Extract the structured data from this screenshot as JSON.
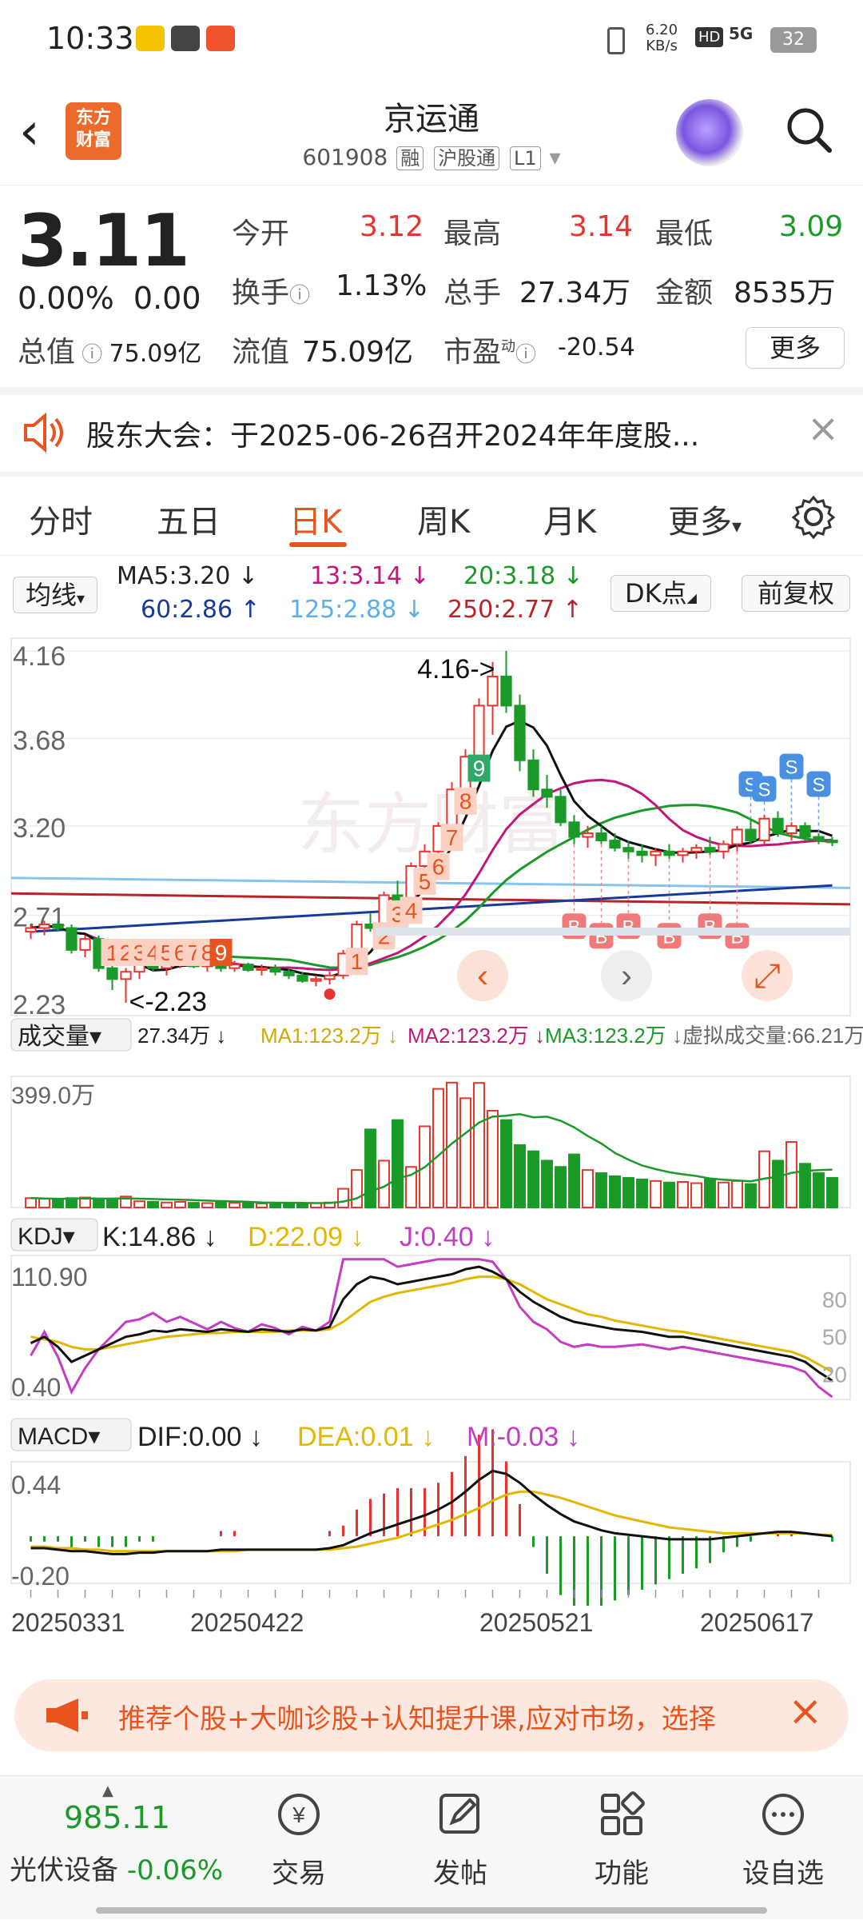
{
  "status": {
    "time": "10:33",
    "net_speed_value": "6.20",
    "net_speed_unit": "KB/s",
    "hd": "HD",
    "signal": "5G",
    "battery": "32"
  },
  "header": {
    "logo_line1": "东方",
    "logo_line2": "财富",
    "title": "京运通",
    "code": "601908",
    "tag1": "融",
    "tag2": "沪股通",
    "tag3": "L1"
  },
  "quote": {
    "price": "3.11",
    "change_pct": "0.00%",
    "change": "0.00",
    "open_label": "今开",
    "open": "3.12",
    "high_label": "最高",
    "high": "3.14",
    "low_label": "最低",
    "low": "3.09",
    "turnover_label": "换手",
    "turnover": "1.13%",
    "volume_label": "总手",
    "volume": "27.34万",
    "amount_label": "金额",
    "amount": "8535万",
    "mktcap_label": "总值",
    "mktcap": "75.09亿",
    "float_label": "流值",
    "float": "75.09亿",
    "pe_label": "市盈",
    "pe_sup": "动",
    "pe": "-20.54",
    "more": "更多"
  },
  "notice": {
    "text": "股东大会：于2025-06-26召开2024年年度股..."
  },
  "tabs": [
    {
      "label": "分时"
    },
    {
      "label": "五日"
    },
    {
      "label": "日K"
    },
    {
      "label": "周K"
    },
    {
      "label": "月K"
    },
    {
      "label": "更多"
    }
  ],
  "ma": {
    "selector": "均线",
    "ma5": "MA5:3.20 ↓",
    "ma13": "13:3.14 ↓",
    "ma20": "20:3.18 ↓",
    "ma60": "60:2.86 ↑",
    "ma125": "125:2.88 ↓",
    "ma250": "250:2.77 ↑",
    "dk": "DK点",
    "fq": "前复权"
  },
  "kline": {
    "y_labels": [
      "4.16",
      "3.68",
      "3.20",
      "2.71",
      "2.23"
    ],
    "max_annot": "4.16->",
    "min_annot": "<-2.23",
    "buy_mark": "B",
    "sell_mark": "S",
    "seq_buy": [
      "1",
      "2",
      "3",
      "4",
      "5",
      "6",
      "7",
      "8",
      "9"
    ],
    "seq_sell": [
      "1",
      "2",
      "3",
      "4",
      "5",
      "6",
      "7",
      "8",
      "9"
    ]
  },
  "volume": {
    "selector": "成交量",
    "vol": "27.34万 ↓",
    "ma1": "MA1:123.2万 ↓",
    "ma2": "MA2:123.2万 ↓",
    "ma3": "MA3:123.2万 ↓",
    "virtual": "虚拟成交量:66.21万",
    "ymax": "399.0万"
  },
  "kdj": {
    "selector": "KDJ",
    "k": "K:14.86 ↓",
    "d": "D:22.09 ↓",
    "j": "J:0.40 ↓",
    "ymax": "110.90",
    "ymin": "0.40",
    "levels": [
      "80",
      "50",
      "20"
    ]
  },
  "macd": {
    "selector": "MACD",
    "dif": "DIF:0.00 ↓",
    "dea": "DEA:0.01 ↓",
    "m": "M:-0.03 ↓",
    "ymax": "0.44",
    "ymin": "-0.20"
  },
  "dates": [
    "20250331",
    "20250422",
    "20250521",
    "20250617"
  ],
  "chart_data": {
    "type": "candlestick",
    "title": "京运通 601908 日K",
    "ylim": [
      2.23,
      4.16
    ],
    "ohlc": [
      [
        2.62,
        2.66,
        2.58,
        2.64
      ],
      [
        2.64,
        2.68,
        2.6,
        2.66
      ],
      [
        2.66,
        2.68,
        2.62,
        2.64
      ],
      [
        2.64,
        2.66,
        2.5,
        2.52
      ],
      [
        2.52,
        2.6,
        2.48,
        2.58
      ],
      [
        2.58,
        2.6,
        2.4,
        2.42
      ],
      [
        2.42,
        2.46,
        2.3,
        2.36
      ],
      [
        2.36,
        2.42,
        2.23,
        2.4
      ],
      [
        2.4,
        2.46,
        2.36,
        2.44
      ],
      [
        2.44,
        2.48,
        2.4,
        2.42
      ],
      [
        2.42,
        2.46,
        2.38,
        2.44
      ],
      [
        2.44,
        2.48,
        2.42,
        2.46
      ],
      [
        2.46,
        2.48,
        2.42,
        2.43
      ],
      [
        2.43,
        2.46,
        2.4,
        2.44
      ],
      [
        2.44,
        2.46,
        2.4,
        2.42
      ],
      [
        2.42,
        2.46,
        2.4,
        2.44
      ],
      [
        2.44,
        2.45,
        2.4,
        2.41
      ],
      [
        2.41,
        2.44,
        2.38,
        2.42
      ],
      [
        2.42,
        2.44,
        2.38,
        2.4
      ],
      [
        2.4,
        2.42,
        2.36,
        2.38
      ],
      [
        2.38,
        2.4,
        2.34,
        2.35
      ],
      [
        2.35,
        2.38,
        2.32,
        2.36
      ],
      [
        2.36,
        2.4,
        2.33,
        2.38
      ],
      [
        2.38,
        2.52,
        2.36,
        2.5
      ],
      [
        2.5,
        2.68,
        2.48,
        2.66
      ],
      [
        2.66,
        2.72,
        2.62,
        2.64
      ],
      [
        2.64,
        2.84,
        2.62,
        2.82
      ],
      [
        2.82,
        2.9,
        2.74,
        2.78
      ],
      [
        2.78,
        3.0,
        2.76,
        2.98
      ],
      [
        2.98,
        3.1,
        2.92,
        3.06
      ],
      [
        3.06,
        3.22,
        3.0,
        3.2
      ],
      [
        3.2,
        3.44,
        3.16,
        3.4
      ],
      [
        3.4,
        3.62,
        3.36,
        3.58
      ],
      [
        3.58,
        3.9,
        3.54,
        3.86
      ],
      [
        3.86,
        4.1,
        3.7,
        4.02
      ],
      [
        4.02,
        4.16,
        3.82,
        3.86
      ],
      [
        3.86,
        3.92,
        3.5,
        3.56
      ],
      [
        3.56,
        3.62,
        3.36,
        3.4
      ],
      [
        3.4,
        3.48,
        3.3,
        3.36
      ],
      [
        3.36,
        3.4,
        3.2,
        3.22
      ],
      [
        3.22,
        3.26,
        3.1,
        3.14
      ],
      [
        3.14,
        3.2,
        3.08,
        3.16
      ],
      [
        3.16,
        3.2,
        3.1,
        3.12
      ],
      [
        3.12,
        3.16,
        3.06,
        3.08
      ],
      [
        3.08,
        3.12,
        3.02,
        3.06
      ],
      [
        3.06,
        3.1,
        3.0,
        3.04
      ],
      [
        3.04,
        3.08,
        2.98,
        3.06
      ],
      [
        3.06,
        3.1,
        3.02,
        3.04
      ],
      [
        3.04,
        3.08,
        3.0,
        3.06
      ],
      [
        3.06,
        3.1,
        3.02,
        3.08
      ],
      [
        3.08,
        3.14,
        3.04,
        3.06
      ],
      [
        3.06,
        3.12,
        3.02,
        3.1
      ],
      [
        3.1,
        3.2,
        3.06,
        3.18
      ],
      [
        3.18,
        3.24,
        3.1,
        3.12
      ],
      [
        3.12,
        3.26,
        3.1,
        3.24
      ],
      [
        3.24,
        3.28,
        3.14,
        3.16
      ],
      [
        3.16,
        3.22,
        3.12,
        3.2
      ],
      [
        3.2,
        3.22,
        3.12,
        3.14
      ],
      [
        3.14,
        3.16,
        3.1,
        3.12
      ],
      [
        3.12,
        3.14,
        3.09,
        3.11
      ]
    ],
    "volume": [
      30,
      28,
      26,
      30,
      32,
      25,
      28,
      35,
      20,
      18,
      16,
      18,
      15,
      14,
      16,
      15,
      14,
      13,
      15,
      14,
      12,
      14,
      16,
      60,
      120,
      250,
      150,
      280,
      130,
      260,
      380,
      400,
      350,
      399,
      310,
      280,
      200,
      180,
      150,
      130,
      170,
      120,
      110,
      100,
      95,
      90,
      85,
      80,
      82,
      78,
      90,
      80,
      85,
      75,
      180,
      150,
      210,
      140,
      110,
      95
    ],
    "kdj_k": [
      45,
      50,
      42,
      30,
      35,
      40,
      45,
      50,
      52,
      55,
      54,
      56,
      55,
      54,
      56,
      55,
      54,
      56,
      55,
      54,
      56,
      55,
      58,
      80,
      92,
      98,
      96,
      92,
      94,
      96,
      98,
      100,
      104,
      106,
      102,
      96,
      86,
      78,
      72,
      66,
      62,
      60,
      58,
      56,
      55,
      54,
      52,
      50,
      50,
      48,
      46,
      44,
      42,
      40,
      38,
      36,
      34,
      30,
      22,
      15
    ],
    "kdj_d": [
      50,
      48,
      46,
      42,
      40,
      40,
      42,
      44,
      46,
      48,
      50,
      51,
      52,
      53,
      53,
      54,
      54,
      54,
      54,
      55,
      55,
      55,
      56,
      62,
      70,
      78,
      82,
      85,
      87,
      89,
      91,
      93,
      96,
      98,
      98,
      96,
      92,
      86,
      80,
      76,
      72,
      68,
      66,
      63,
      61,
      59,
      57,
      55,
      54,
      52,
      50,
      48,
      46,
      44,
      42,
      40,
      38,
      34,
      28,
      22
    ],
    "macd_dif": [
      -0.08,
      -0.08,
      -0.09,
      -0.1,
      -0.1,
      -0.11,
      -0.12,
      -0.12,
      -0.11,
      -0.11,
      -0.1,
      -0.1,
      -0.1,
      -0.1,
      -0.09,
      -0.09,
      -0.09,
      -0.09,
      -0.09,
      -0.09,
      -0.09,
      -0.09,
      -0.08,
      -0.06,
      -0.02,
      0.02,
      0.05,
      0.08,
      0.11,
      0.14,
      0.18,
      0.23,
      0.3,
      0.38,
      0.44,
      0.42,
      0.36,
      0.28,
      0.21,
      0.15,
      0.1,
      0.07,
      0.04,
      0.02,
      0.01,
      0.0,
      -0.01,
      -0.02,
      -0.02,
      -0.02,
      -0.02,
      -0.01,
      0.0,
      0.01,
      0.02,
      0.03,
      0.03,
      0.02,
      0.01,
      0.0
    ],
    "macd_dea": [
      -0.07,
      -0.07,
      -0.08,
      -0.08,
      -0.09,
      -0.09,
      -0.1,
      -0.1,
      -0.1,
      -0.1,
      -0.1,
      -0.1,
      -0.1,
      -0.1,
      -0.1,
      -0.1,
      -0.09,
      -0.09,
      -0.09,
      -0.09,
      -0.09,
      -0.09,
      -0.09,
      -0.08,
      -0.07,
      -0.05,
      -0.03,
      -0.01,
      0.02,
      0.05,
      0.08,
      0.11,
      0.15,
      0.19,
      0.24,
      0.28,
      0.3,
      0.3,
      0.28,
      0.26,
      0.23,
      0.2,
      0.17,
      0.14,
      0.12,
      0.1,
      0.08,
      0.06,
      0.05,
      0.04,
      0.03,
      0.02,
      0.02,
      0.02,
      0.02,
      0.02,
      0.02,
      0.02,
      0.01,
      0.01
    ]
  },
  "banner": {
    "text": "推荐个股+大咖诊股+认知提升课,应对市场，选择"
  },
  "bottom": {
    "index_value": "985.11",
    "index_name": "光伏设备",
    "index_change": "-0.06%",
    "nav": [
      {
        "label": "交易"
      },
      {
        "label": "发帖"
      },
      {
        "label": "功能"
      },
      {
        "label": "设自选"
      }
    ]
  }
}
